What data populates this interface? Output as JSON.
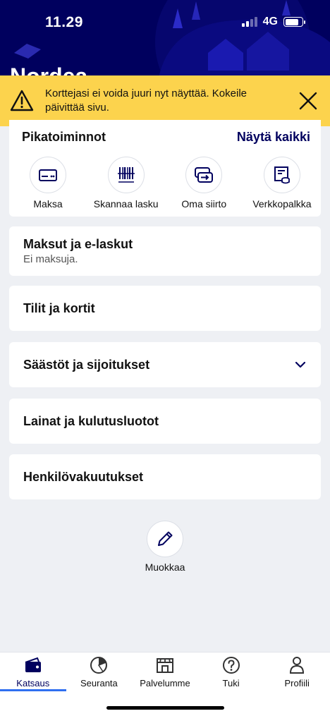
{
  "status_bar": {
    "time": "11.29",
    "network": "4G"
  },
  "header": {
    "brand": "Nordea"
  },
  "alert": {
    "message": "Korttejasi ei voida juuri nyt näyttää. Kokeile päivittää sivu."
  },
  "quick_actions": {
    "title": "Pikatoiminnot",
    "show_all": "Näytä kaikki",
    "items": [
      {
        "label": "Maksa",
        "icon": "card-icon"
      },
      {
        "label": "Skannaa lasku",
        "icon": "barcode-icon"
      },
      {
        "label": "Oma siirto",
        "icon": "transfer-icon"
      },
      {
        "label": "Verkkopalkka",
        "icon": "payslip-icon"
      }
    ]
  },
  "sections": [
    {
      "title": "Maksut ja e-laskut",
      "subtitle": "Ei maksuja."
    },
    {
      "title": "Tilit ja kortit"
    },
    {
      "title": "Säästöt ja sijoitukset"
    },
    {
      "title": "Lainat ja kulutusluotot"
    },
    {
      "title": "Henkilövakuutukset"
    }
  ],
  "edit": {
    "label": "Muokkaa"
  },
  "tabbar": {
    "active": "Katsaus",
    "items": [
      {
        "label": "Katsaus",
        "icon": "wallet-icon"
      },
      {
        "label": "Seuranta",
        "icon": "pie-chart-icon"
      },
      {
        "label": "Palvelumme",
        "icon": "store-icon"
      },
      {
        "label": "Tuki",
        "icon": "help-icon"
      },
      {
        "label": "Profiili",
        "icon": "person-icon"
      }
    ]
  },
  "colors": {
    "brand_navy": "#00005e",
    "alert_yellow": "#fcd34d",
    "page_bg": "#eef0f4",
    "active_indicator": "#2f6ff0"
  }
}
